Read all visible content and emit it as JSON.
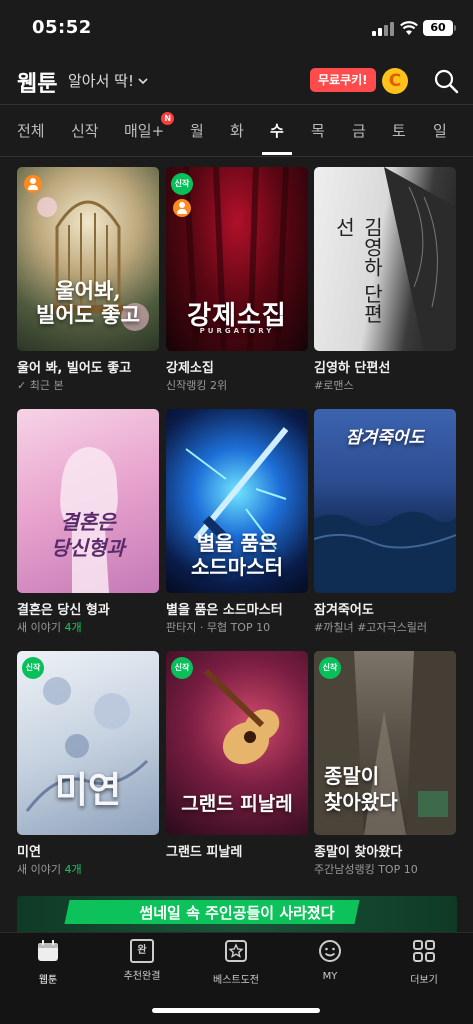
{
  "status": {
    "time": "05:52",
    "battery": "60"
  },
  "header": {
    "title": "웹툰",
    "sort_label": "알아서 딱!",
    "cookie_button": "무료쿠키!",
    "coin_letter": "C"
  },
  "tabs": [
    {
      "label": "전체",
      "active": false
    },
    {
      "label": "신작",
      "active": false
    },
    {
      "label": "매일+",
      "active": false,
      "badge": "N"
    },
    {
      "label": "월",
      "active": false
    },
    {
      "label": "화",
      "active": false
    },
    {
      "label": "수",
      "active": true
    },
    {
      "label": "목",
      "active": false
    },
    {
      "label": "금",
      "active": false
    },
    {
      "label": "토",
      "active": false
    },
    {
      "label": "일",
      "active": false
    }
  ],
  "comics": [
    {
      "title": "울어 봐, 빌어도 좋고",
      "sub": "최근 본",
      "cover": "울어봐,\n빌어도 좋고",
      "new": false,
      "person": true
    },
    {
      "title": "강제소집",
      "sub": "신작랭킹 2위",
      "cover": "강제소집",
      "cover_sub": "PURGATORY",
      "new": true,
      "new_label": "신작",
      "person": true
    },
    {
      "title": "김영하 단편선",
      "sub": "#로맨스",
      "cover": "김영하 단편선",
      "new": false,
      "person": false
    },
    {
      "title": "결혼은 당신 형과",
      "sub_prefix": "새 이야기 ",
      "sub_count": "4개",
      "cover": "결혼은\n당신형과",
      "new": false,
      "person": false
    },
    {
      "title": "별을 품은 소드마스터",
      "sub": "판타지 · 무협 TOP 10",
      "cover": "별을 품은\n소드마스터",
      "new": false,
      "person": false
    },
    {
      "title": "잠겨죽어도",
      "sub": "#까칠녀 #고자극스릴러",
      "cover": "잠겨죽어도",
      "new": false,
      "person": false
    },
    {
      "title": "미연",
      "sub_prefix": "새 이야기 ",
      "sub_count": "4개",
      "cover": "미연",
      "new": true,
      "new_label": "신작",
      "person": false
    },
    {
      "title": "그랜드 피날레",
      "sub": "",
      "cover": "그랜드 피날레",
      "new": true,
      "new_label": "신작",
      "person": false
    },
    {
      "title": "종말이 찾아왔다",
      "sub": "주간남성랭킹 TOP 10",
      "cover": "종말이\n찾아왔다",
      "new": true,
      "new_label": "신작",
      "person": false
    }
  ],
  "banner": {
    "text": "썸네일 속 주인공들이 사라졌다"
  },
  "bottom_nav": [
    {
      "label": "웹툰",
      "icon": "calendar-icon"
    },
    {
      "label": "추천완결",
      "icon": "book-icon",
      "glyph": "완"
    },
    {
      "label": "베스트도전",
      "icon": "star-box-icon"
    },
    {
      "label": "MY",
      "icon": "smile-icon"
    },
    {
      "label": "더보기",
      "icon": "grid-icon"
    }
  ],
  "colors": {
    "background": "#1b1b1b",
    "accent_green": "#17c964",
    "cookie_red": "#ff4b4b",
    "coin_yellow": "#ffc21a"
  }
}
